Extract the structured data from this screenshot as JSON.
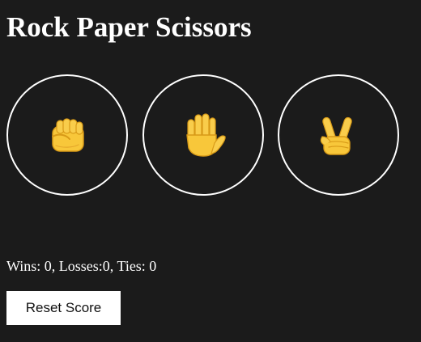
{
  "game": {
    "title": "Rock Paper Scissors"
  },
  "choices": [
    {
      "name": "Rock",
      "icon": "raised-fist-icon"
    },
    {
      "name": "Paper",
      "icon": "raised-hand-icon"
    },
    {
      "name": "Scissors",
      "icon": "victory-hand-icon"
    }
  ],
  "score": {
    "text": "Wins: 0, Losses:0, Ties: 0",
    "wins": 0,
    "losses": 0,
    "ties": 0
  },
  "controls": {
    "reset_label": "Reset Score"
  },
  "colors": {
    "background": "#1b1b1b",
    "circle_border": "#ffffff",
    "emoji_fill": "#f8c73a",
    "emoji_shade": "#e0a21f"
  }
}
